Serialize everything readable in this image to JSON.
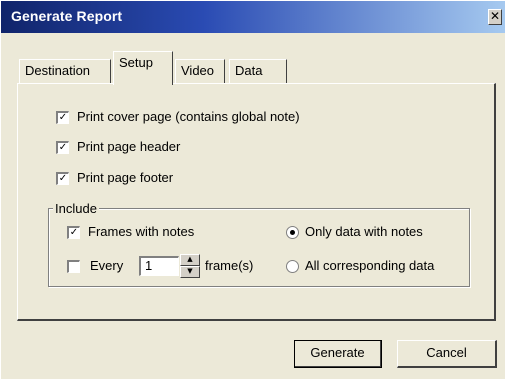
{
  "window": {
    "title": "Generate Report",
    "close_glyph": "✕"
  },
  "tabs": [
    {
      "label": "Destination",
      "active": false
    },
    {
      "label": "Setup",
      "active": true
    },
    {
      "label": "Video",
      "active": false
    },
    {
      "label": "Data",
      "active": false
    }
  ],
  "setup": {
    "cover_page": {
      "label": "Print cover page (contains global note)",
      "checked": true
    },
    "page_header": {
      "label": "Print page header",
      "checked": true
    },
    "page_footer": {
      "label": "Print page footer",
      "checked": true
    }
  },
  "include": {
    "legend": "Include",
    "frames_with_notes": {
      "label": "Frames with notes",
      "checked": true
    },
    "every": {
      "label": "Every",
      "checked": false,
      "value": "1",
      "suffix": "frame(s)"
    },
    "only_data_with_notes": {
      "label": "Only data with notes",
      "selected": true
    },
    "all_corresponding_data": {
      "label": "All corresponding data",
      "selected": false
    }
  },
  "buttons": {
    "generate": "Generate",
    "cancel": "Cancel"
  },
  "glyphs": {
    "check": "✓",
    "spin_up": "▲",
    "spin_down": "▼"
  }
}
